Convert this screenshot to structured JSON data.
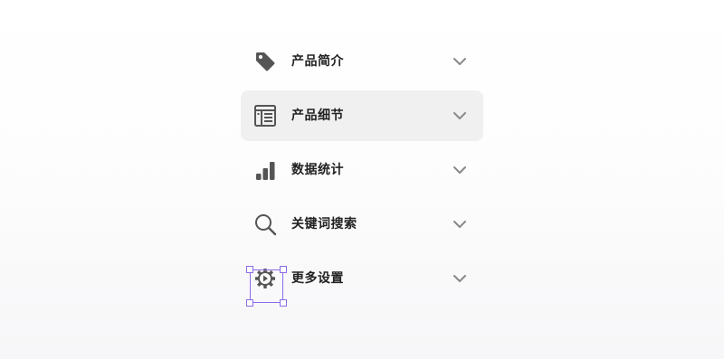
{
  "menu": {
    "items": [
      {
        "label": "产品简介",
        "icon": "tag-icon",
        "active": false
      },
      {
        "label": "产品细节",
        "icon": "document-list-icon",
        "active": true
      },
      {
        "label": "数据统计",
        "icon": "bar-chart-icon",
        "active": false
      },
      {
        "label": "关键词搜索",
        "icon": "search-icon",
        "active": false
      },
      {
        "label": "更多设置",
        "icon": "gear-icon",
        "active": false,
        "selected": true
      }
    ]
  },
  "colors": {
    "icon": "#555555",
    "text": "#222222",
    "chevron": "#888888",
    "active_bg": "#f0f0f0",
    "selection": "#8b6ce6"
  }
}
